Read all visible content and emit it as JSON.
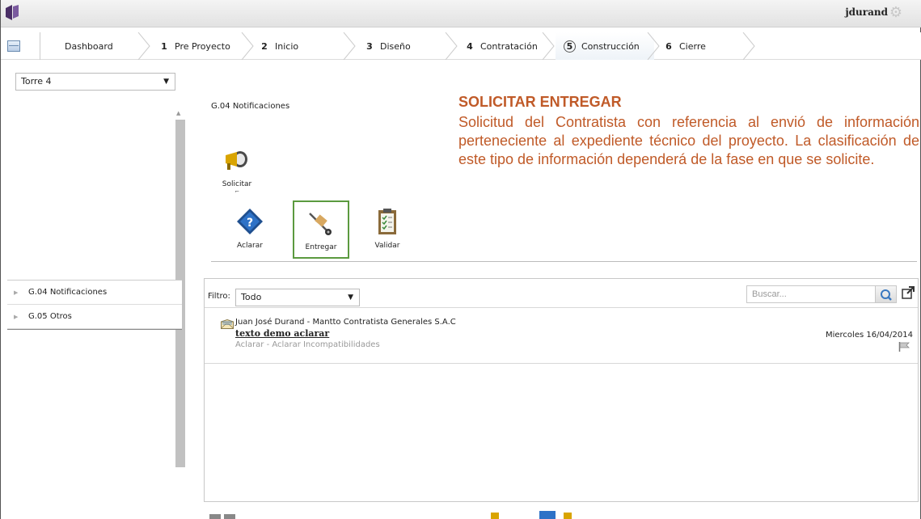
{
  "header": {
    "username": "jdurand"
  },
  "steps": [
    {
      "num": "",
      "label": "Dashboard"
    },
    {
      "num": "1",
      "label": "Pre Proyecto"
    },
    {
      "num": "2",
      "label": "Inicio"
    },
    {
      "num": "3",
      "label": "Diseño"
    },
    {
      "num": "4",
      "label": "Contratación"
    },
    {
      "num": "5",
      "label": "Construcción",
      "active": true
    },
    {
      "num": "6",
      "label": "Cierre"
    }
  ],
  "sidebar": {
    "selected_project": "Torre 4",
    "items": [
      {
        "label": "G.04 Notificaciones"
      },
      {
        "label": "G.05 Otros"
      }
    ]
  },
  "main": {
    "section_title": "G.04 Notificaciones",
    "tools": {
      "solicitar": "Solicitar",
      "aclarar": "Aclarar",
      "entregar": "Entregar",
      "validar": "Validar"
    },
    "description": {
      "title": "SOLICITAR ENTREGAR",
      "body": "Solicitud del Contratista con referencia al envió de información perteneciente al expediente técnico del proyecto. La clasificación de este tipo de información dependerá de la fase en que se solicite."
    },
    "list": {
      "filter_label": "Filtro:",
      "filter_value": "Todo",
      "search_placeholder": "Buscar...",
      "messages": [
        {
          "sender": "Juan José Durand - Mantto Contratista Generales S.A.C",
          "subject": "texto demo aclarar",
          "type": "Aclarar - Aclarar Incompatibilidades",
          "date": "Miercoles 16/04/2014"
        }
      ]
    }
  },
  "colors": {
    "accent_orange": "#c05a28",
    "highlight_green": "#5b9a3f",
    "brand_purple": "#5b3f7a"
  }
}
